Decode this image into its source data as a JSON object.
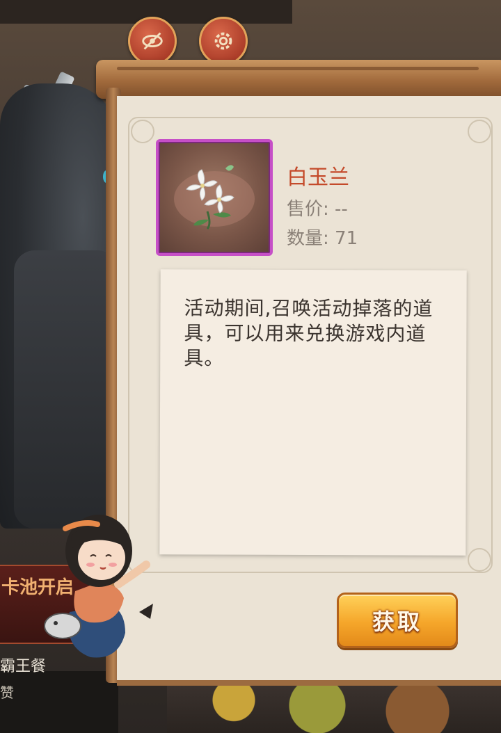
{
  "top_buttons": [
    {
      "label": "",
      "icon": "eye-slash-icon"
    },
    {
      "label": "",
      "icon": "gear-icon"
    }
  ],
  "background": {
    "event_banner_text": "卡池开启",
    "meal_label": "霸王餐",
    "meal_sub": "赞"
  },
  "item": {
    "name": "白玉兰",
    "price_label": "售价: --",
    "count_label": "数量: 71",
    "icon": "white-magnolia-flower-icon",
    "rarity_color": "#c64fc7",
    "description": "活动期间,召唤活动掉落的道具，可以用来兑换游戏内道具。"
  },
  "actions": {
    "obtain_label": "获取"
  },
  "colors": {
    "name_color": "#c44a2a",
    "button_color": "#f5a62a"
  }
}
